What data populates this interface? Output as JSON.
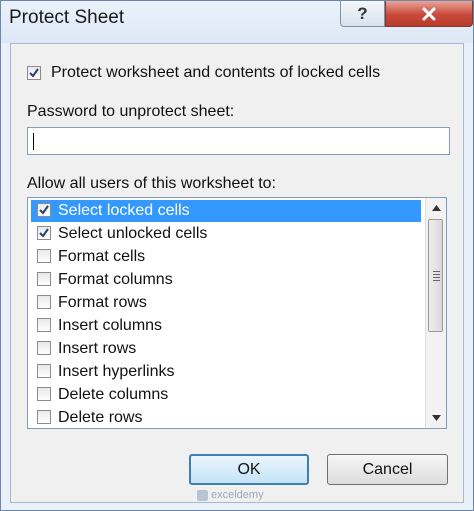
{
  "dialog": {
    "title": "Protect Sheet",
    "help_label": "?"
  },
  "protect_checkbox": {
    "label": "Protect worksheet and contents of locked cells",
    "checked": true
  },
  "password": {
    "label": "Password to unprotect sheet:",
    "value": ""
  },
  "allow": {
    "label": "Allow all users of this worksheet to:",
    "items": [
      {
        "label": "Select locked cells",
        "checked": true,
        "selected": true
      },
      {
        "label": "Select unlocked cells",
        "checked": true,
        "selected": false
      },
      {
        "label": "Format cells",
        "checked": false,
        "selected": false
      },
      {
        "label": "Format columns",
        "checked": false,
        "selected": false
      },
      {
        "label": "Format rows",
        "checked": false,
        "selected": false
      },
      {
        "label": "Insert columns",
        "checked": false,
        "selected": false
      },
      {
        "label": "Insert rows",
        "checked": false,
        "selected": false
      },
      {
        "label": "Insert hyperlinks",
        "checked": false,
        "selected": false
      },
      {
        "label": "Delete columns",
        "checked": false,
        "selected": false
      },
      {
        "label": "Delete rows",
        "checked": false,
        "selected": false
      }
    ]
  },
  "buttons": {
    "ok": "OK",
    "cancel": "Cancel"
  },
  "watermark": {
    "text": "exceldemy"
  },
  "colors": {
    "selection": "#3399ff",
    "close_button": "#c8493a",
    "dialog_frame": "#eaf0f9"
  }
}
